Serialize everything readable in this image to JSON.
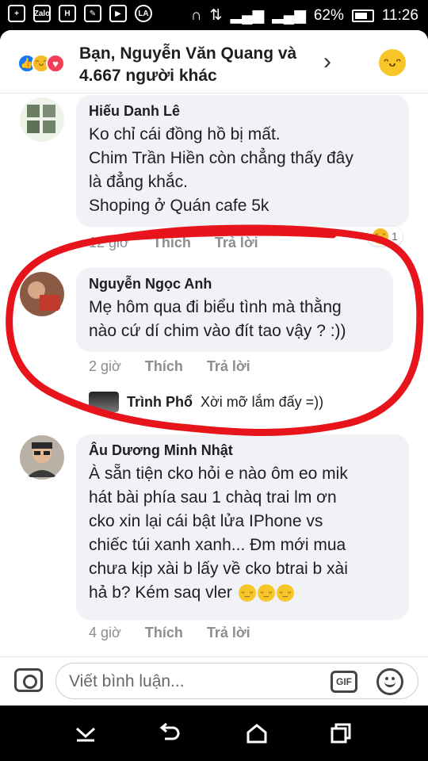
{
  "status_bar": {
    "left_icons": [
      "plus-icon",
      "zalo-icon",
      "h-icon",
      "leaf-icon",
      "youtube-icon",
      "la-icon"
    ],
    "zalo_label": "Zalo",
    "la_label": "LA",
    "battery": "62%",
    "time": "11:26"
  },
  "header": {
    "reactions_text": "Bạn, Nguyễn Văn Quang và 4.667 người khác"
  },
  "comments": [
    {
      "name": "Hiếu Danh Lê",
      "text": [
        "Ko chỉ cái đồng hồ bị mất.",
        "Chim Trần Hiền còn chẳng thấy đây",
        "là đẳng khắc.",
        "Shoping ở Quán cafe 5k"
      ],
      "time": "12 giờ",
      "like": "Thích",
      "reply": "Trả lời",
      "reaction_count": "1"
    },
    {
      "name": "Nguyễn Ngọc Anh",
      "text": [
        "Mẹ hôm qua đi biểu tình mà thằng",
        "nào cứ dí chim vào đít tao vậy ? :))"
      ],
      "time": "2 giờ",
      "like": "Thích",
      "reply": "Trả lời",
      "reply_preview": {
        "name": "Trình Phổ",
        "text": "Xời mỡ lắm đấy =))"
      }
    },
    {
      "name": "Âu Dương Minh Nhật",
      "text": [
        "À sẵn tiện cko hỏi e nào ôm eo mik",
        "hát bài phía sau 1 chàq trai lm ơn",
        "cko xin lại cái bật lửa IPhone vs",
        "chiếc túi xanh xanh... Đm mới mua",
        "chưa kịp xài b lấy về cko btrai b xài",
        "hả b? Kém saq vler"
      ],
      "time": "4 giờ",
      "like": "Thích",
      "reply": "Trả lời"
    }
  ],
  "composer": {
    "placeholder": "Viết bình luận...",
    "gif_label": "GIF"
  },
  "colors": {
    "annotation_red": "#e8141c",
    "bubble_bg": "#f0f2f5",
    "like_blue": "#1877f2"
  }
}
